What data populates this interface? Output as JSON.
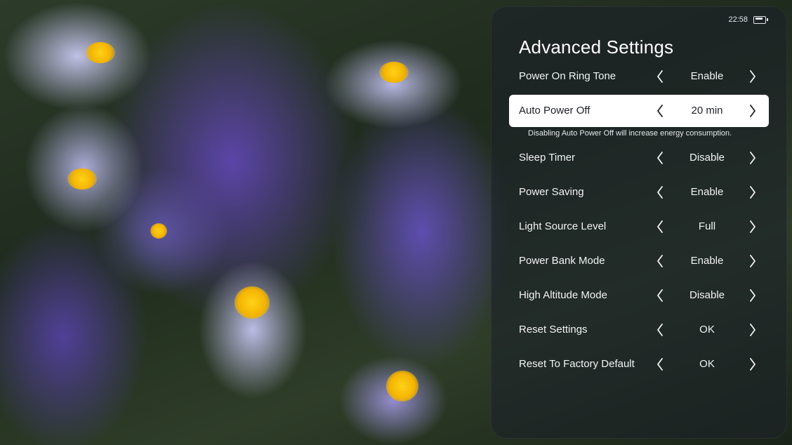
{
  "status": {
    "time": "22:58",
    "battery_icon": "battery-icon"
  },
  "menu": {
    "title": "Advanced Settings",
    "hint": "Disabling Auto Power Off will increase energy consumption.",
    "items": [
      {
        "label": "Power On Ring Tone",
        "value": "Enable",
        "selected": false
      },
      {
        "label": "Auto Power Off",
        "value": "20 min",
        "selected": true
      },
      {
        "label": "Sleep Timer",
        "value": "Disable",
        "selected": false
      },
      {
        "label": "Power Saving",
        "value": "Enable",
        "selected": false
      },
      {
        "label": "Light Source Level",
        "value": "Full",
        "selected": false
      },
      {
        "label": "Power Bank Mode",
        "value": "Enable",
        "selected": false
      },
      {
        "label": "High Altitude Mode",
        "value": "Disable",
        "selected": false
      },
      {
        "label": "Reset Settings",
        "value": "OK",
        "selected": false
      },
      {
        "label": "Reset To Factory Default",
        "value": "OK",
        "selected": false
      }
    ]
  },
  "colors": {
    "panel": "#1c2228",
    "selected_row": "#ffffff",
    "selected_text": "#1c1f24",
    "text": "#f2f3f5"
  }
}
